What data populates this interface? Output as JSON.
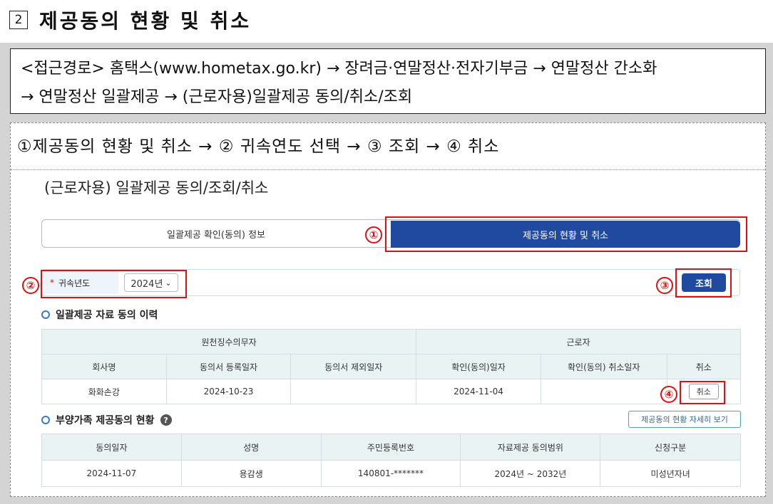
{
  "heading": {
    "number": "2",
    "title": "제공동의 현황 및 취소"
  },
  "access_path": {
    "line1": "<접근경로> 홈택스(www.hometax.go.kr) → 장려금·연말정산·전자기부금 → 연말정산 간소화",
    "line2": "→ 연말정산 일괄제공 → (근로자용)일괄제공 동의/취소/조회"
  },
  "steps_text": "①제공동의 현황 및 취소 → ② 귀속연도 선택 → ③ 조회 → ④ 취소",
  "app": {
    "title": "(근로자용) 일괄제공 동의/조회/취소",
    "tabs": [
      {
        "label": "일괄제공 확인(동의) 정보"
      },
      {
        "label": "제공동의 현황 및 취소"
      }
    ],
    "year_label": "귀속년도",
    "required_mark": "*",
    "year_value": "2024년",
    "year_caret": "⌄",
    "query_label": "조회",
    "history": {
      "title": "일괄제공 자료 동의 이력",
      "group_headers": [
        "원천징수의무자",
        "근로자"
      ],
      "columns": [
        "회사명",
        "동의서 등록일자",
        "동의서 제외일자",
        "확인(동의)일자",
        "확인(동의) 취소일자",
        "취소"
      ],
      "row": {
        "company": "화화손강",
        "registered": "2024-10-23",
        "excluded": "",
        "confirmed": "2024-11-04",
        "cancelled": "",
        "cancel_label": "취소"
      }
    },
    "dependents": {
      "title": "부양가족 제공동의 현황",
      "help_icon": "?",
      "detail_label": "제공동의 현황 자세히 보기",
      "columns": [
        "동의일자",
        "성명",
        "주민등록번호",
        "자료제공 동의범위",
        "신청구분"
      ],
      "row": {
        "date": "2024-11-07",
        "name": "용감생",
        "rrn": "140801-*******",
        "range": "2024년 ~ 2032년",
        "type": "미성년자녀"
      }
    }
  },
  "callouts": [
    "①",
    "②",
    "③",
    "④"
  ],
  "colors": {
    "accent_blue": "#1f4aa0",
    "highlight_red": "#e01010",
    "table_header": "#e9f3f3"
  }
}
